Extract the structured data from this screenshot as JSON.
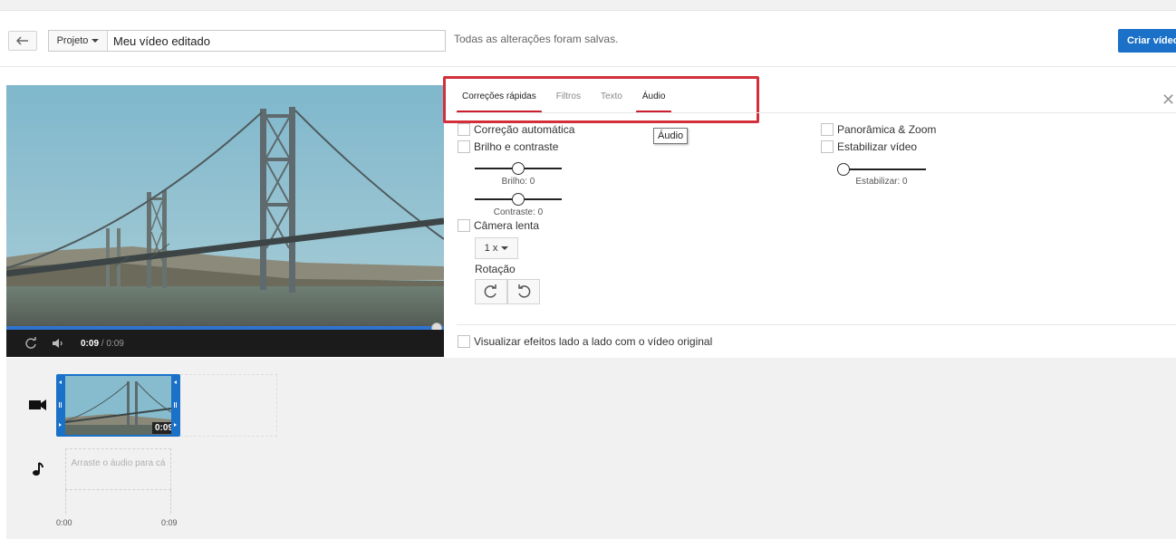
{
  "toolbar": {
    "project_label": "Projeto",
    "project_name": "Meu vídeo editado",
    "saved_message": "Todas as alterações foram salvas.",
    "create_button": "Criar vídeo"
  },
  "player": {
    "time_current": "0:09",
    "time_separator": "/",
    "time_total": "0:09",
    "progress": 1.0
  },
  "editor": {
    "tabs": [
      {
        "label": "Correções rápidas",
        "active": true
      },
      {
        "label": "Filtros",
        "active": false
      },
      {
        "label": "Texto",
        "active": false
      },
      {
        "label": "Áudio",
        "active": false,
        "hovered": true
      }
    ],
    "tooltip": "Áudio",
    "close_icon": "close-icon",
    "options": {
      "auto_correct": "Correção automática",
      "brightness_contrast": "Brilho e contraste",
      "brightness_label": "Brilho: 0",
      "contrast_label": "Contraste: 0",
      "slow_motion": "Câmera lenta",
      "speed_value": "1 x",
      "rotation_label": "Rotação",
      "pan_zoom": "Panorâmica & Zoom",
      "stabilize": "Estabilizar vídeo",
      "stabilize_label": "Estabilizar: 0",
      "side_by_side": "Visualizar efeitos lado a lado com o vídeo original"
    },
    "slider_values": {
      "brightness": 0.5,
      "contrast": 0.5,
      "stabilize": 0.0
    },
    "highlight_color": "#d32f3b"
  },
  "timeline": {
    "clip_duration": "0:09",
    "audio_drop_text": "Arraste o áudio para cá",
    "tick_start": "0:00",
    "tick_end": "0:09"
  },
  "colors": {
    "accent": "#1b70c8",
    "progress": "#2f74d0"
  }
}
